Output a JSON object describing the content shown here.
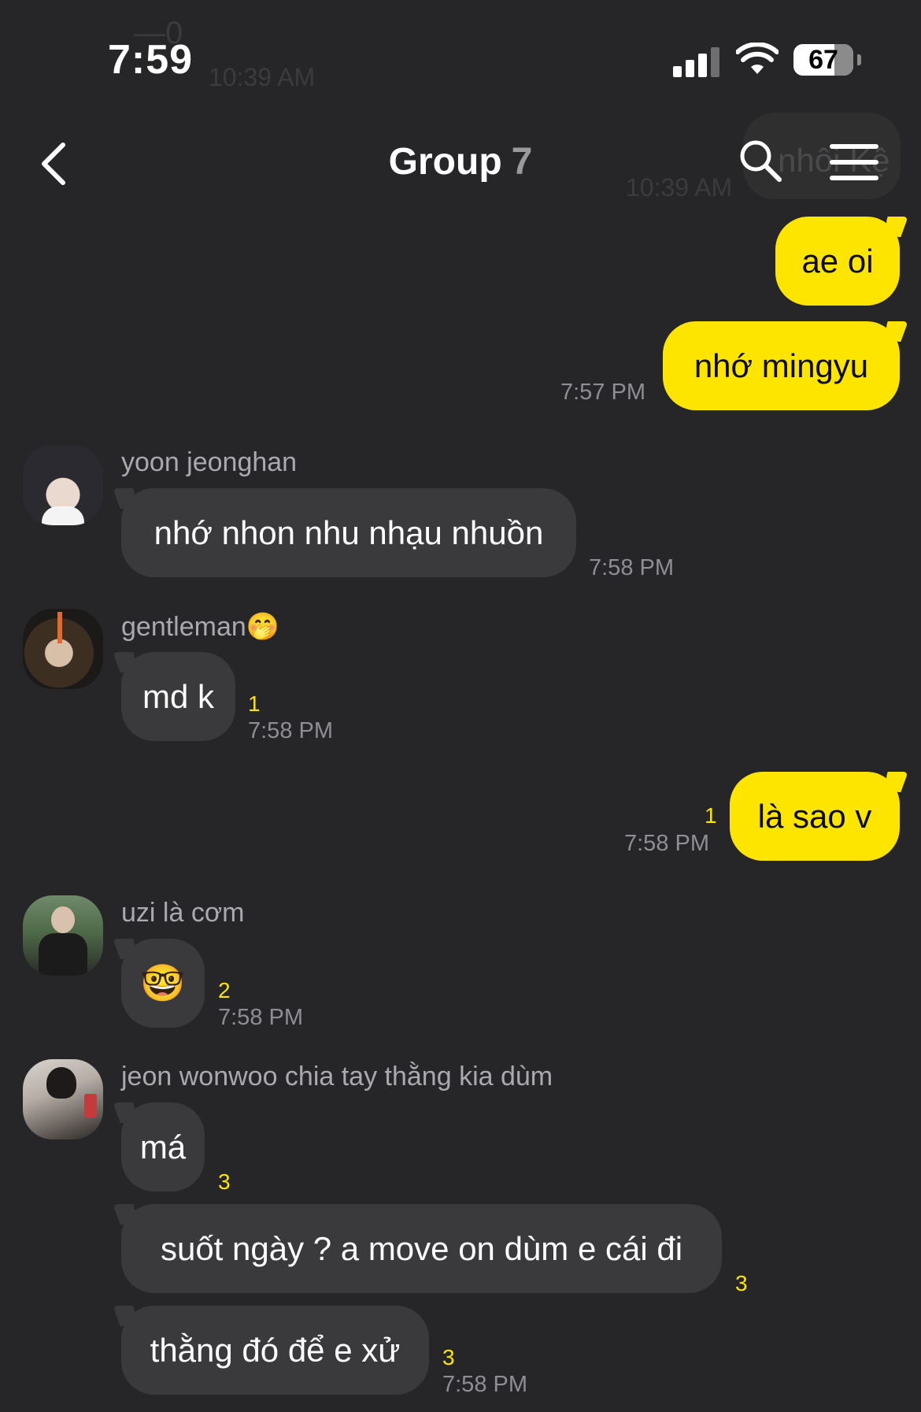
{
  "status_bar": {
    "time": "7:59",
    "battery": "67"
  },
  "ghost": {
    "text1": "10:39 AM",
    "text2": "10:39 AM",
    "text3": "nhôi Kệ",
    "text4": "—0"
  },
  "header": {
    "title": "Group",
    "member_count": "7"
  },
  "messages": [
    {
      "type": "mine",
      "text": "ae oi"
    },
    {
      "type": "mine",
      "text": "nhớ mingyu",
      "time": "7:57 PM"
    },
    {
      "type": "theirs",
      "sender": "yoon jeonghan",
      "text": "nhớ nhon nhu nhạu nhuồn",
      "time": "7:58 PM"
    },
    {
      "type": "theirs",
      "sender": "gentleman",
      "sender_emoji": "🤭",
      "text": "md k",
      "unread": "1",
      "time": "7:58 PM"
    },
    {
      "type": "mine",
      "text": "là sao v",
      "unread": "1",
      "time": "7:58 PM"
    },
    {
      "type": "theirs",
      "sender": "uzi là cơm",
      "text": "🤓",
      "unread": "2",
      "time": "7:58 PM"
    },
    {
      "type": "theirs",
      "sender": "jeon wonwoo chia tay thằng kia dùm",
      "text": "má",
      "unread": "3"
    },
    {
      "type": "theirs",
      "text": "suốt ngày ? a move on dùm e cái đi",
      "unread": "3"
    },
    {
      "type": "theirs",
      "text": "thằng đó để e xử",
      "unread": "3",
      "time": "7:58 PM"
    }
  ]
}
